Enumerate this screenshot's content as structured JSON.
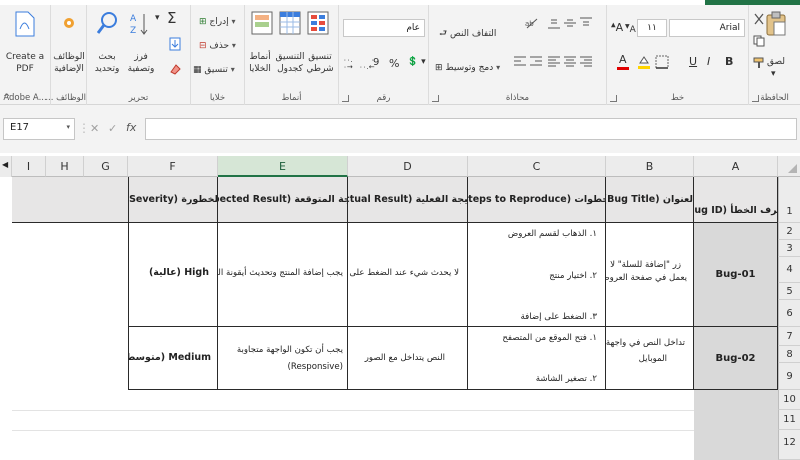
{
  "ribbon": {
    "clipboard": {
      "label": "الحافظة",
      "paste": "لصق"
    },
    "font": {
      "label": "خط",
      "name": "Arial",
      "size": "١١",
      "bold": "B",
      "italic": "I",
      "underline": "U",
      "grow": "A",
      "shrink": "A",
      "fontcolor": "A"
    },
    "alignment": {
      "label": "محاذاة",
      "wrap": "التفاف النص",
      "merge": "دمج وتوسيط"
    },
    "number": {
      "label": "رقم",
      "format": "عام",
      "percent": "%",
      "comma": "9",
      "inc": "٠٠٠",
      "dec": "٠٠"
    },
    "styles": {
      "label": "أنماط",
      "conditional": "تنسيق شرطي",
      "table": "التنسيق كجدول",
      "cells": "أنماط الخلايا"
    },
    "cells": {
      "label": "خلايا",
      "insert": "إدراج",
      "delete": "حذف",
      "format": "تنسيق"
    },
    "editing": {
      "label": "تحرير",
      "sort": "فرز وتصفية",
      "find": "بحث وتحديد"
    },
    "addins": {
      "label": "الوظائف ...",
      "btn": "الوظائف الإضافية"
    },
    "adobe": {
      "label": "Adobe A...",
      "btn": "Create a PDF"
    }
  },
  "formula_bar": {
    "name_box": "E17",
    "fx": "fx",
    "cancel": "✕",
    "enter": "✓",
    "content": ""
  },
  "columns": [
    {
      "id": "A",
      "label": "A"
    },
    {
      "id": "B",
      "label": "B"
    },
    {
      "id": "C",
      "label": "C"
    },
    {
      "id": "D",
      "label": "D"
    },
    {
      "id": "E",
      "label": "E"
    },
    {
      "id": "F",
      "label": "F"
    },
    {
      "id": "G",
      "label": "G"
    },
    {
      "id": "H",
      "label": "H"
    },
    {
      "id": "I",
      "label": "I"
    }
  ],
  "rows": [
    "1",
    "2",
    "3",
    "4",
    "5",
    "6",
    "7",
    "8",
    "9",
    "10",
    "11",
    "12"
  ],
  "table": {
    "headers": {
      "a": "معرف الخطأ (Bug ID)",
      "b": "العنوان (Bug Title)",
      "c": "الخطوات (Steps to Reproduce)",
      "d": "النتيجة الفعلية (Actual Result)",
      "e": "النتيجة المتوقعة (Expected Result)",
      "f": "الخطورة (Severity)"
    },
    "bug1": {
      "id": "Bug-01",
      "title_1": "زر \"إضافة للسلة\" لا",
      "title_2": "يعمل في صفحة العروض",
      "step1": "١. الذهاب لقسم العروض",
      "step2": "٢. اختيار منتج",
      "step3": "٣. الضغط على إضافة",
      "actual": "لا يحدث شيء عند الضغط على الزر",
      "expected": "يجب إضافة المنتج وتحديث أيقونة السلة",
      "severity": "High (عالية)"
    },
    "bug2": {
      "id": "Bug-02",
      "title_1": "تداخل النص في واجهة",
      "title_2": "الموبايل",
      "step1": "١. فتح الموقع من المتصفح",
      "step2": "٢. تصغير الشاشة",
      "actual": "النص يتداخل مع الصور",
      "expected_1": "يجب أن تكون الواجهة متجاوبة",
      "expected_2": "(Responsive)",
      "severity": "Medium (متوسطة)"
    }
  }
}
